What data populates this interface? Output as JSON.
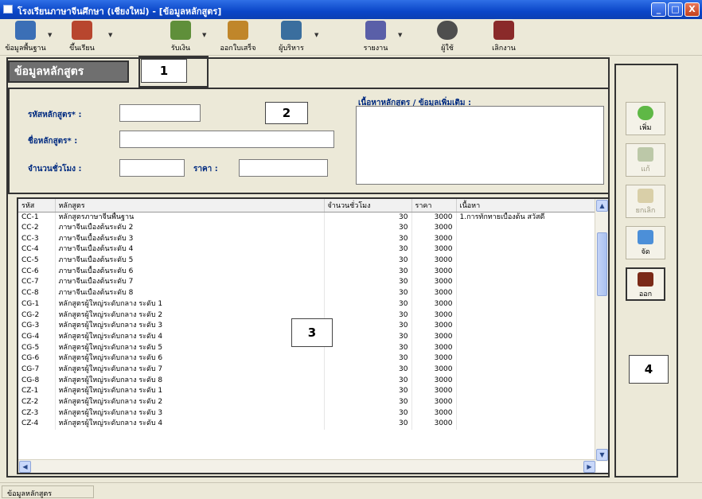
{
  "window": {
    "title": "โรงเรียนภาษาจีนศึกษา (เชียงใหม่) - [ข้อมูลหลักสูตร]",
    "minimize": "_",
    "maximize": "□",
    "close": "X"
  },
  "toolbar": {
    "items": [
      {
        "label": "ข้อมูลพื้นฐาน",
        "icon": "book-icon",
        "color": "#3b6fb6"
      },
      {
        "label": "ขึ้นเรียน",
        "icon": "school-icon",
        "color": "#b8462e"
      },
      {
        "label": "รับเงิน",
        "icon": "money-icon",
        "color": "#5f8f3a"
      },
      {
        "label": "ออกใบเสร็จ",
        "icon": "receipt-icon",
        "color": "#c0862a"
      },
      {
        "label": "ผู้บริหาร",
        "icon": "admin-icon",
        "color": "#3a6e9e"
      },
      {
        "label": "รายงาน",
        "icon": "report-icon",
        "color": "#5a5fa8"
      },
      {
        "label": "ผู้ใช้",
        "icon": "user-icon",
        "color": "#4e4e4e"
      },
      {
        "label": "เลิกงาน",
        "icon": "exit-icon",
        "color": "#8a2a2a"
      }
    ]
  },
  "form": {
    "tab_title": "ข้อมูลหลักสูตร",
    "annotations": {
      "a1": "1",
      "a2": "2",
      "a3": "3",
      "a4": "4"
    },
    "fields": {
      "code_label": "รหัสหลักสูตร* :",
      "code_value": "",
      "name_label": "ชื่อหลักสูตร* :",
      "name_value": "",
      "hours_label": "จำนวนชั่วโมง :",
      "hours_value": "",
      "price_label": "ราคา :",
      "price_value": "",
      "content_label": "เนื้อหาหลักสูตร / ข้อมูลเพิ่มเติม :",
      "content_value": ""
    }
  },
  "grid": {
    "columns": [
      "รหัส",
      "หลักสูตร",
      "จำนวนชั่วโมง",
      "ราคา",
      "เนื้อหา"
    ],
    "rows": [
      [
        "CC-1",
        "หลักสูตรภาษาจีนพื้นฐาน",
        "30",
        "3000",
        "1.การทักทายเบื้องต้น สวัสดี"
      ],
      [
        "CC-2",
        "ภาษาจีนเบื้องต้นระดับ 2",
        "30",
        "3000",
        ""
      ],
      [
        "CC-3",
        "ภาษาจีนเบื้องต้นระดับ 3",
        "30",
        "3000",
        ""
      ],
      [
        "CC-4",
        "ภาษาจีนเบื้องต้นระดับ 4",
        "30",
        "3000",
        ""
      ],
      [
        "CC-5",
        "ภาษาจีนเบื้องต้นระดับ 5",
        "30",
        "3000",
        ""
      ],
      [
        "CC-6",
        "ภาษาจีนเบื้องต้นระดับ 6",
        "30",
        "3000",
        ""
      ],
      [
        "CC-7",
        "ภาษาจีนเบื้องต้นระดับ 7",
        "30",
        "3000",
        ""
      ],
      [
        "CC-8",
        "ภาษาจีนเบื้องต้นระดับ 8",
        "30",
        "3000",
        ""
      ],
      [
        "CG-1",
        "หลักสูตรผู้ใหญ่ระดับกลาง ระดับ 1",
        "30",
        "3000",
        ""
      ],
      [
        "CG-2",
        "หลักสูตรผู้ใหญ่ระดับกลาง ระดับ 2",
        "30",
        "3000",
        ""
      ],
      [
        "CG-3",
        "หลักสูตรผู้ใหญ่ระดับกลาง ระดับ 3",
        "30",
        "3000",
        ""
      ],
      [
        "CG-4",
        "หลักสูตรผู้ใหญ่ระดับกลาง ระดับ 4",
        "30",
        "3000",
        ""
      ],
      [
        "CG-5",
        "หลักสูตรผู้ใหญ่ระดับกลาง ระดับ 5",
        "30",
        "3000",
        ""
      ],
      [
        "CG-6",
        "หลักสูตรผู้ใหญ่ระดับกลาง ระดับ 6",
        "30",
        "3000",
        ""
      ],
      [
        "CG-7",
        "หลักสูตรผู้ใหญ่ระดับกลาง ระดับ 7",
        "30",
        "3000",
        ""
      ],
      [
        "CG-8",
        "หลักสูตรผู้ใหญ่ระดับกลาง ระดับ 8",
        "30",
        "3000",
        ""
      ],
      [
        "CZ-1",
        "หลักสูตรผู้ใหญ่ระดับกลาง ระดับ 1",
        "30",
        "3000",
        ""
      ],
      [
        "CZ-2",
        "หลักสูตรผู้ใหญ่ระดับกลาง ระดับ 2",
        "30",
        "3000",
        ""
      ],
      [
        "CZ-3",
        "หลักสูตรผู้ใหญ่ระดับกลาง ระดับ 3",
        "30",
        "3000",
        ""
      ],
      [
        "CZ-4",
        "หลักสูตรผู้ใหญ่ระดับกลาง ระดับ 4",
        "30",
        "3000",
        ""
      ]
    ]
  },
  "side": {
    "add": "เพิ่ม",
    "edit": "แก้",
    "cancel": "ยกเลิก",
    "save": "จัด",
    "exit": "ออก"
  },
  "status": {
    "text": "ข้อมูลหลักสูตร"
  }
}
